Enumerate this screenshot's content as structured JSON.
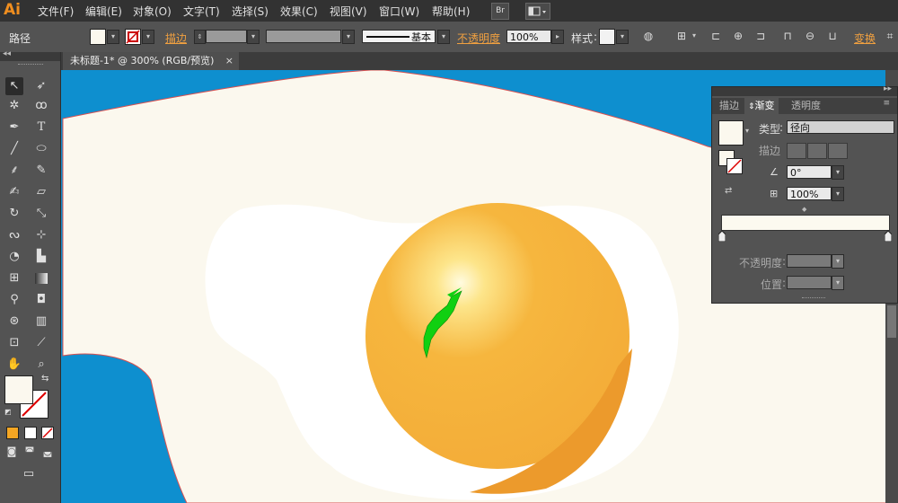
{
  "app": {
    "logo": "Ai"
  },
  "menu": [
    "文件(F)",
    "编辑(E)",
    "对象(O)",
    "文字(T)",
    "选择(S)",
    "效果(C)",
    "视图(V)",
    "窗口(W)",
    "帮助(H)"
  ],
  "menubar_buttons": {
    "bridge": "Br"
  },
  "control": {
    "object_type": "路径",
    "stroke_label": "描边",
    "stroke_style": "基本",
    "opacity_label": "不透明度",
    "opacity_value": "100%",
    "style_label": "样式",
    "transform_label": "变换"
  },
  "document_tab": {
    "title": "未标题-1* @ 300% (RGB/预览)",
    "close": "×"
  },
  "gradient_panel": {
    "tabs": [
      "描边",
      "渐变",
      "透明度"
    ],
    "active_tab": "渐变",
    "type_label": "类型",
    "type_value": "径向",
    "stroke_label": "描边",
    "angle_value": "0°",
    "aspect_value": "100%",
    "opacity_label": "不透明度",
    "location_label": "位置"
  },
  "colors": {
    "accent": "#f08e1f",
    "canvas_blue": "#0e8fcf",
    "egg_white": "#fbf8ee",
    "yolk": "#f5b23c"
  },
  "icons": [
    "selection-tool-icon",
    "direct-selection-icon",
    "magic-wand-icon",
    "lasso-icon",
    "pen-icon",
    "type-icon",
    "line-icon",
    "ellipse-icon",
    "paintbrush-icon",
    "pencil-icon",
    "blob-brush-icon",
    "eraser-icon",
    "rotate-icon",
    "scale-icon",
    "warp-icon",
    "free-transform-icon",
    "shape-builder-icon",
    "perspective-grid-icon",
    "mesh-icon",
    "gradient-icon",
    "eyedropper-icon",
    "blend-icon",
    "symbol-sprayer-icon",
    "column-graph-icon",
    "artboard-icon",
    "slice-icon",
    "hand-icon",
    "zoom-icon"
  ]
}
